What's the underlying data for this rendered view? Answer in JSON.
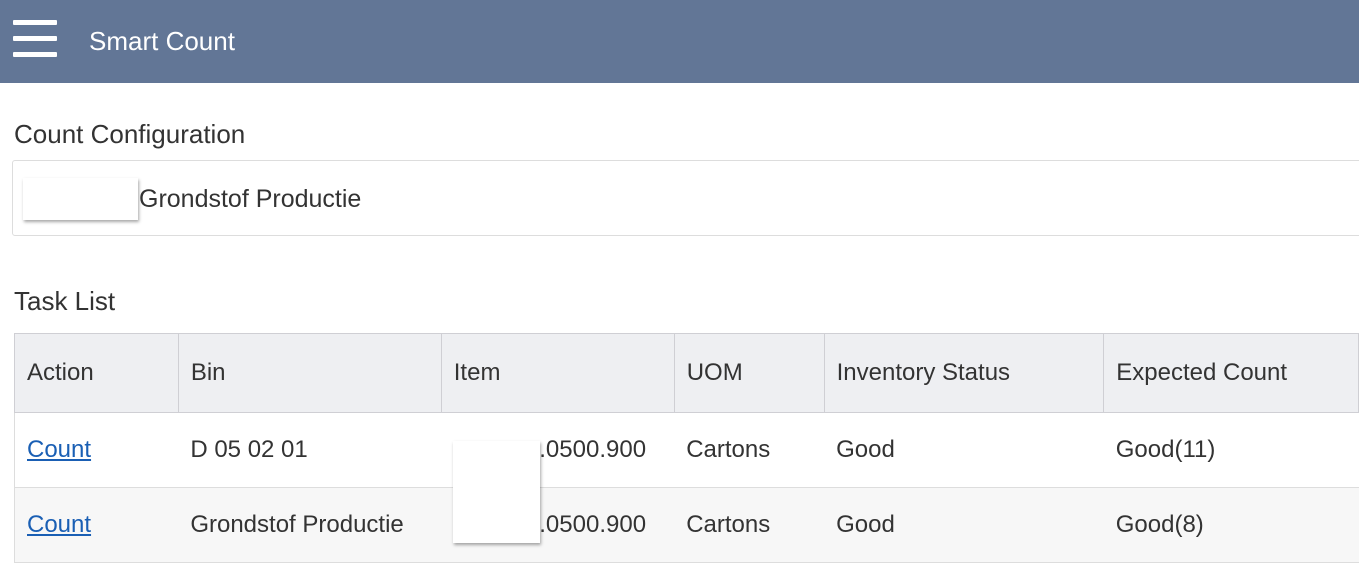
{
  "header": {
    "menu_icon": "hamburger-menu-icon",
    "title": "Smart Count",
    "bar_color": "#627696"
  },
  "config": {
    "heading": "Count Configuration",
    "value": "Grondstof Productie"
  },
  "tasks": {
    "heading": "Task List",
    "columns": [
      "Action",
      "Bin",
      "Item",
      "UOM",
      "Inventory Status",
      "Expected Count"
    ],
    "rows": [
      {
        "action": "Count",
        "bin": "D 05 02 01",
        "item": ".0500.900",
        "uom": "Cartons",
        "status": "Good",
        "expected": "Good(11)"
      },
      {
        "action": "Count",
        "bin": "Grondstof Productie",
        "item": ".0500.900",
        "uom": "Cartons",
        "status": "Good",
        "expected": "Good(8)"
      }
    ]
  },
  "link_color": "#1a5fb4"
}
